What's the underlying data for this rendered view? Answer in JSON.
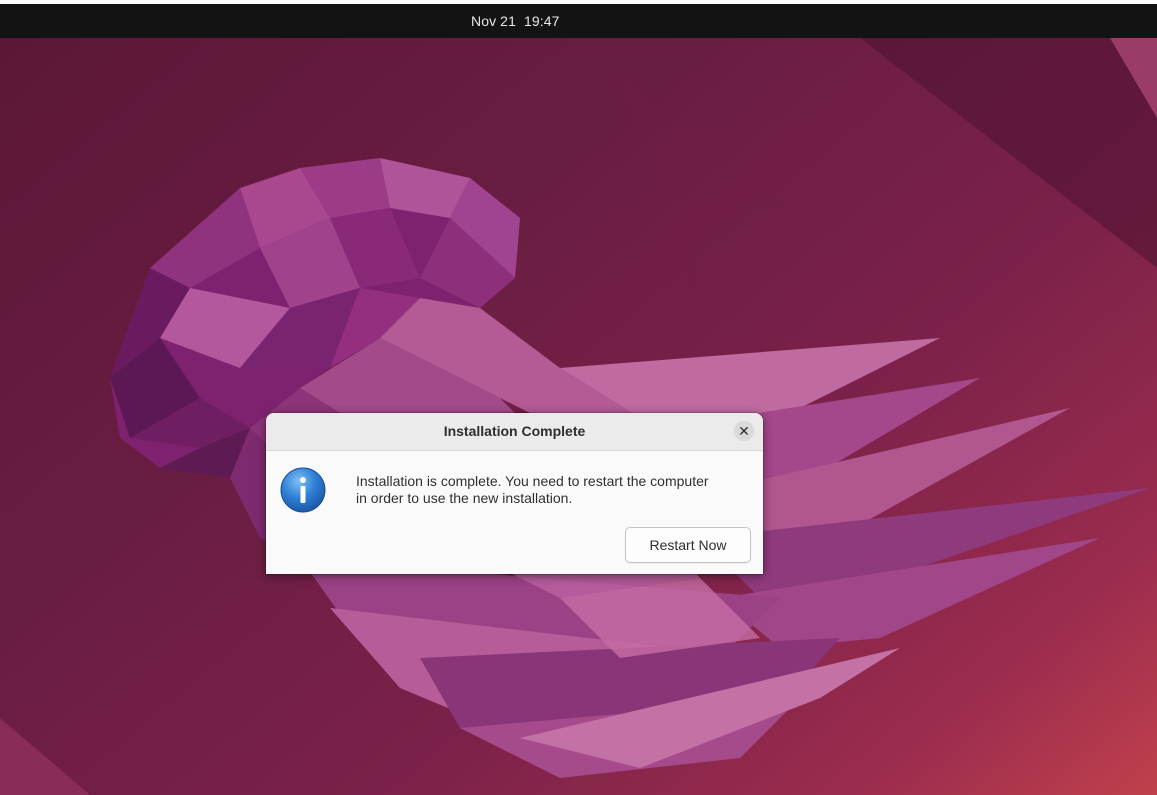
{
  "topbar": {
    "date": "Nov 21",
    "time": "19:47"
  },
  "desktop": {
    "wallpaper": "Ubuntu jellyfish wallpaper",
    "colors": {
      "background_dark": "#5c1736",
      "background_mid": "#7b2149",
      "background_light": "#c0404c",
      "jellyfish_primary": "#8a2a78",
      "jellyfish_light": "#b1508c"
    }
  },
  "dialog": {
    "title": "Installation Complete",
    "close_icon": "close-icon",
    "info_icon": "info-icon",
    "message_line1": "Installation is complete. You need to restart the computer",
    "message_line2": "in order to use the new installation.",
    "restart_label": "Restart Now",
    "colors": {
      "info_blue": "#2f7fd6",
      "titlebar": "#ebebeb",
      "body": "#fafafa"
    }
  }
}
